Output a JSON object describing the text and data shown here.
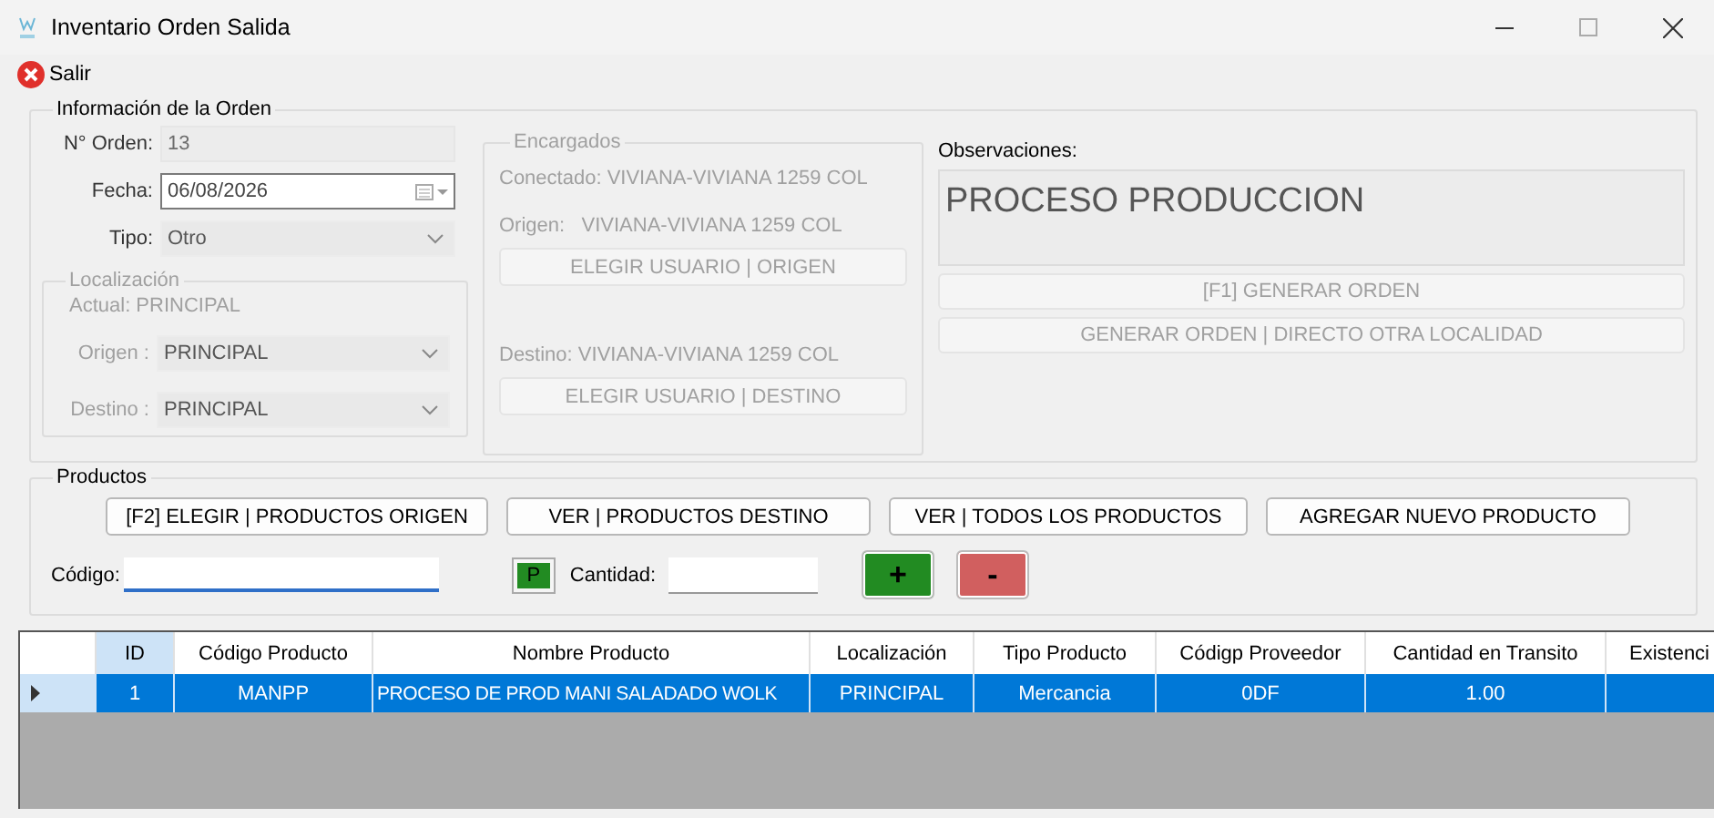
{
  "window": {
    "title": "Inventario Orden Salida"
  },
  "toolbar": [
    {
      "label": "Salir"
    }
  ],
  "order_info": {
    "title": "Información de la Orden",
    "order_number": {
      "label": "N° Orden:",
      "value": "13"
    },
    "date": {
      "label": "Fecha:",
      "value": "06/08/2026"
    },
    "type": {
      "label": "Tipo:",
      "value": "Otro"
    },
    "location": {
      "title": "Localización",
      "disabled": true,
      "current": "Actual: PRINCIPAL",
      "origin": {
        "label": "Origen :",
        "value": "PRINCIPAL"
      },
      "destination": {
        "label": "Destino :",
        "value": "PRINCIPAL"
      }
    },
    "managers": {
      "title": "Encargados",
      "disabled": true,
      "connected": "Conectado: VIVIANA-VIVIANA 1259 COL",
      "origin": {
        "label": "Origen:",
        "value": "VIVIANA-VIVIANA 1259 COL",
        "button": "ELEGIR USUARIO | ORIGEN"
      },
      "destination": {
        "label": "Destino:",
        "value": "VIVIANA-VIVIANA 1259 COL",
        "button": "ELEGIR USUARIO | DESTINO"
      }
    },
    "observations": {
      "label": "Observaciones:",
      "value": "PROCESO PRODUCCION"
    },
    "actions": [
      {
        "label": "[F1]   GENERAR ORDEN",
        "disabled": true
      },
      {
        "label": "GENERAR ORDEN | DIRECTO OTRA LOCALIDAD",
        "disabled": true
      }
    ]
  },
  "products": {
    "title": "Productos",
    "buttons": [
      {
        "label": "[F2]  ELEGIR | PRODUCTOS ORIGEN",
        "disabled": false
      },
      {
        "label": "VER | PRODUCTOS DESTINO",
        "disabled": false
      },
      {
        "label": "VER | TODOS LOS PRODUCTOS",
        "disabled": false
      },
      {
        "label": "AGREGAR NUEVO PRODUCTO",
        "disabled": false
      }
    ],
    "code": {
      "label": "Código:"
    },
    "p_button": "P",
    "quantity": {
      "label": "Cantidad:"
    },
    "add_button": "+",
    "remove_button": "-"
  },
  "table": {
    "columns": [
      "ID",
      "Código Producto",
      "Nombre Producto",
      "Localización",
      "Tipo Producto",
      "Códigp Proveedor",
      "Cantidad en Transito",
      "Existenci"
    ],
    "rows": [
      {
        "selected": true,
        "cells": [
          "1",
          "MANPP",
          "PROCESO DE PROD MANI SALADADO WOLK",
          "PRINCIPAL",
          "Mercancia",
          "0DF",
          "1.00"
        ]
      }
    ]
  }
}
